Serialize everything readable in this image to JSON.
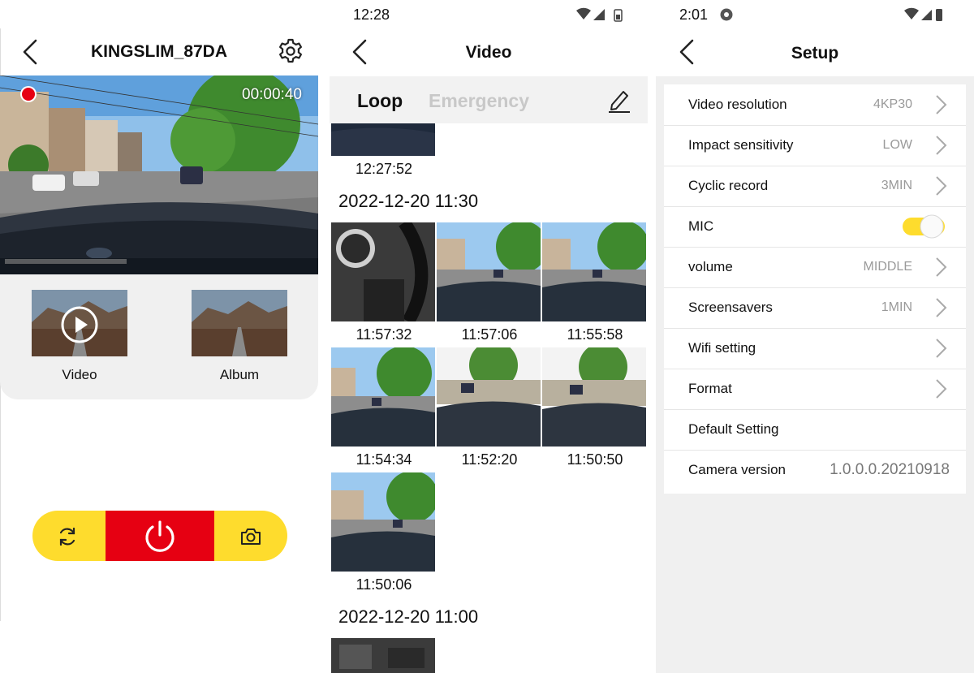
{
  "home": {
    "device_name": "KINGSLIM_87DA",
    "timer": "00:00:40",
    "video_label": "Video",
    "album_label": "Album",
    "colors": {
      "accent": "#fedc2d",
      "record": "#e60012"
    }
  },
  "video_list": {
    "status_time": "12:28",
    "title": "Video",
    "tabs": [
      "Loop",
      "Emergency"
    ],
    "first_time": "12:27:52",
    "group1": "2022-12-20 11:30",
    "items": [
      "11:57:32",
      "11:57:06",
      "11:55:58",
      "11:54:34",
      "11:52:20",
      "11:50:50",
      "11:50:06"
    ],
    "group2": "2022-12-20 11:00"
  },
  "setup": {
    "status_time": "2:01",
    "title": "Setup",
    "rows": [
      {
        "label": "Video resolution",
        "value": "4KP30"
      },
      {
        "label": "Impact sensitivity",
        "value": "LOW"
      },
      {
        "label": "Cyclic record",
        "value": "3MIN"
      },
      {
        "label": "MIC",
        "value": ""
      },
      {
        "label": "volume",
        "value": "MIDDLE"
      },
      {
        "label": "Screensavers",
        "value": "1MIN"
      },
      {
        "label": "Wifi setting",
        "value": ""
      },
      {
        "label": "Format",
        "value": ""
      },
      {
        "label": "Default Setting",
        "value": ""
      },
      {
        "label": "Camera version",
        "value": "1.0.0.0.20210918"
      }
    ]
  }
}
